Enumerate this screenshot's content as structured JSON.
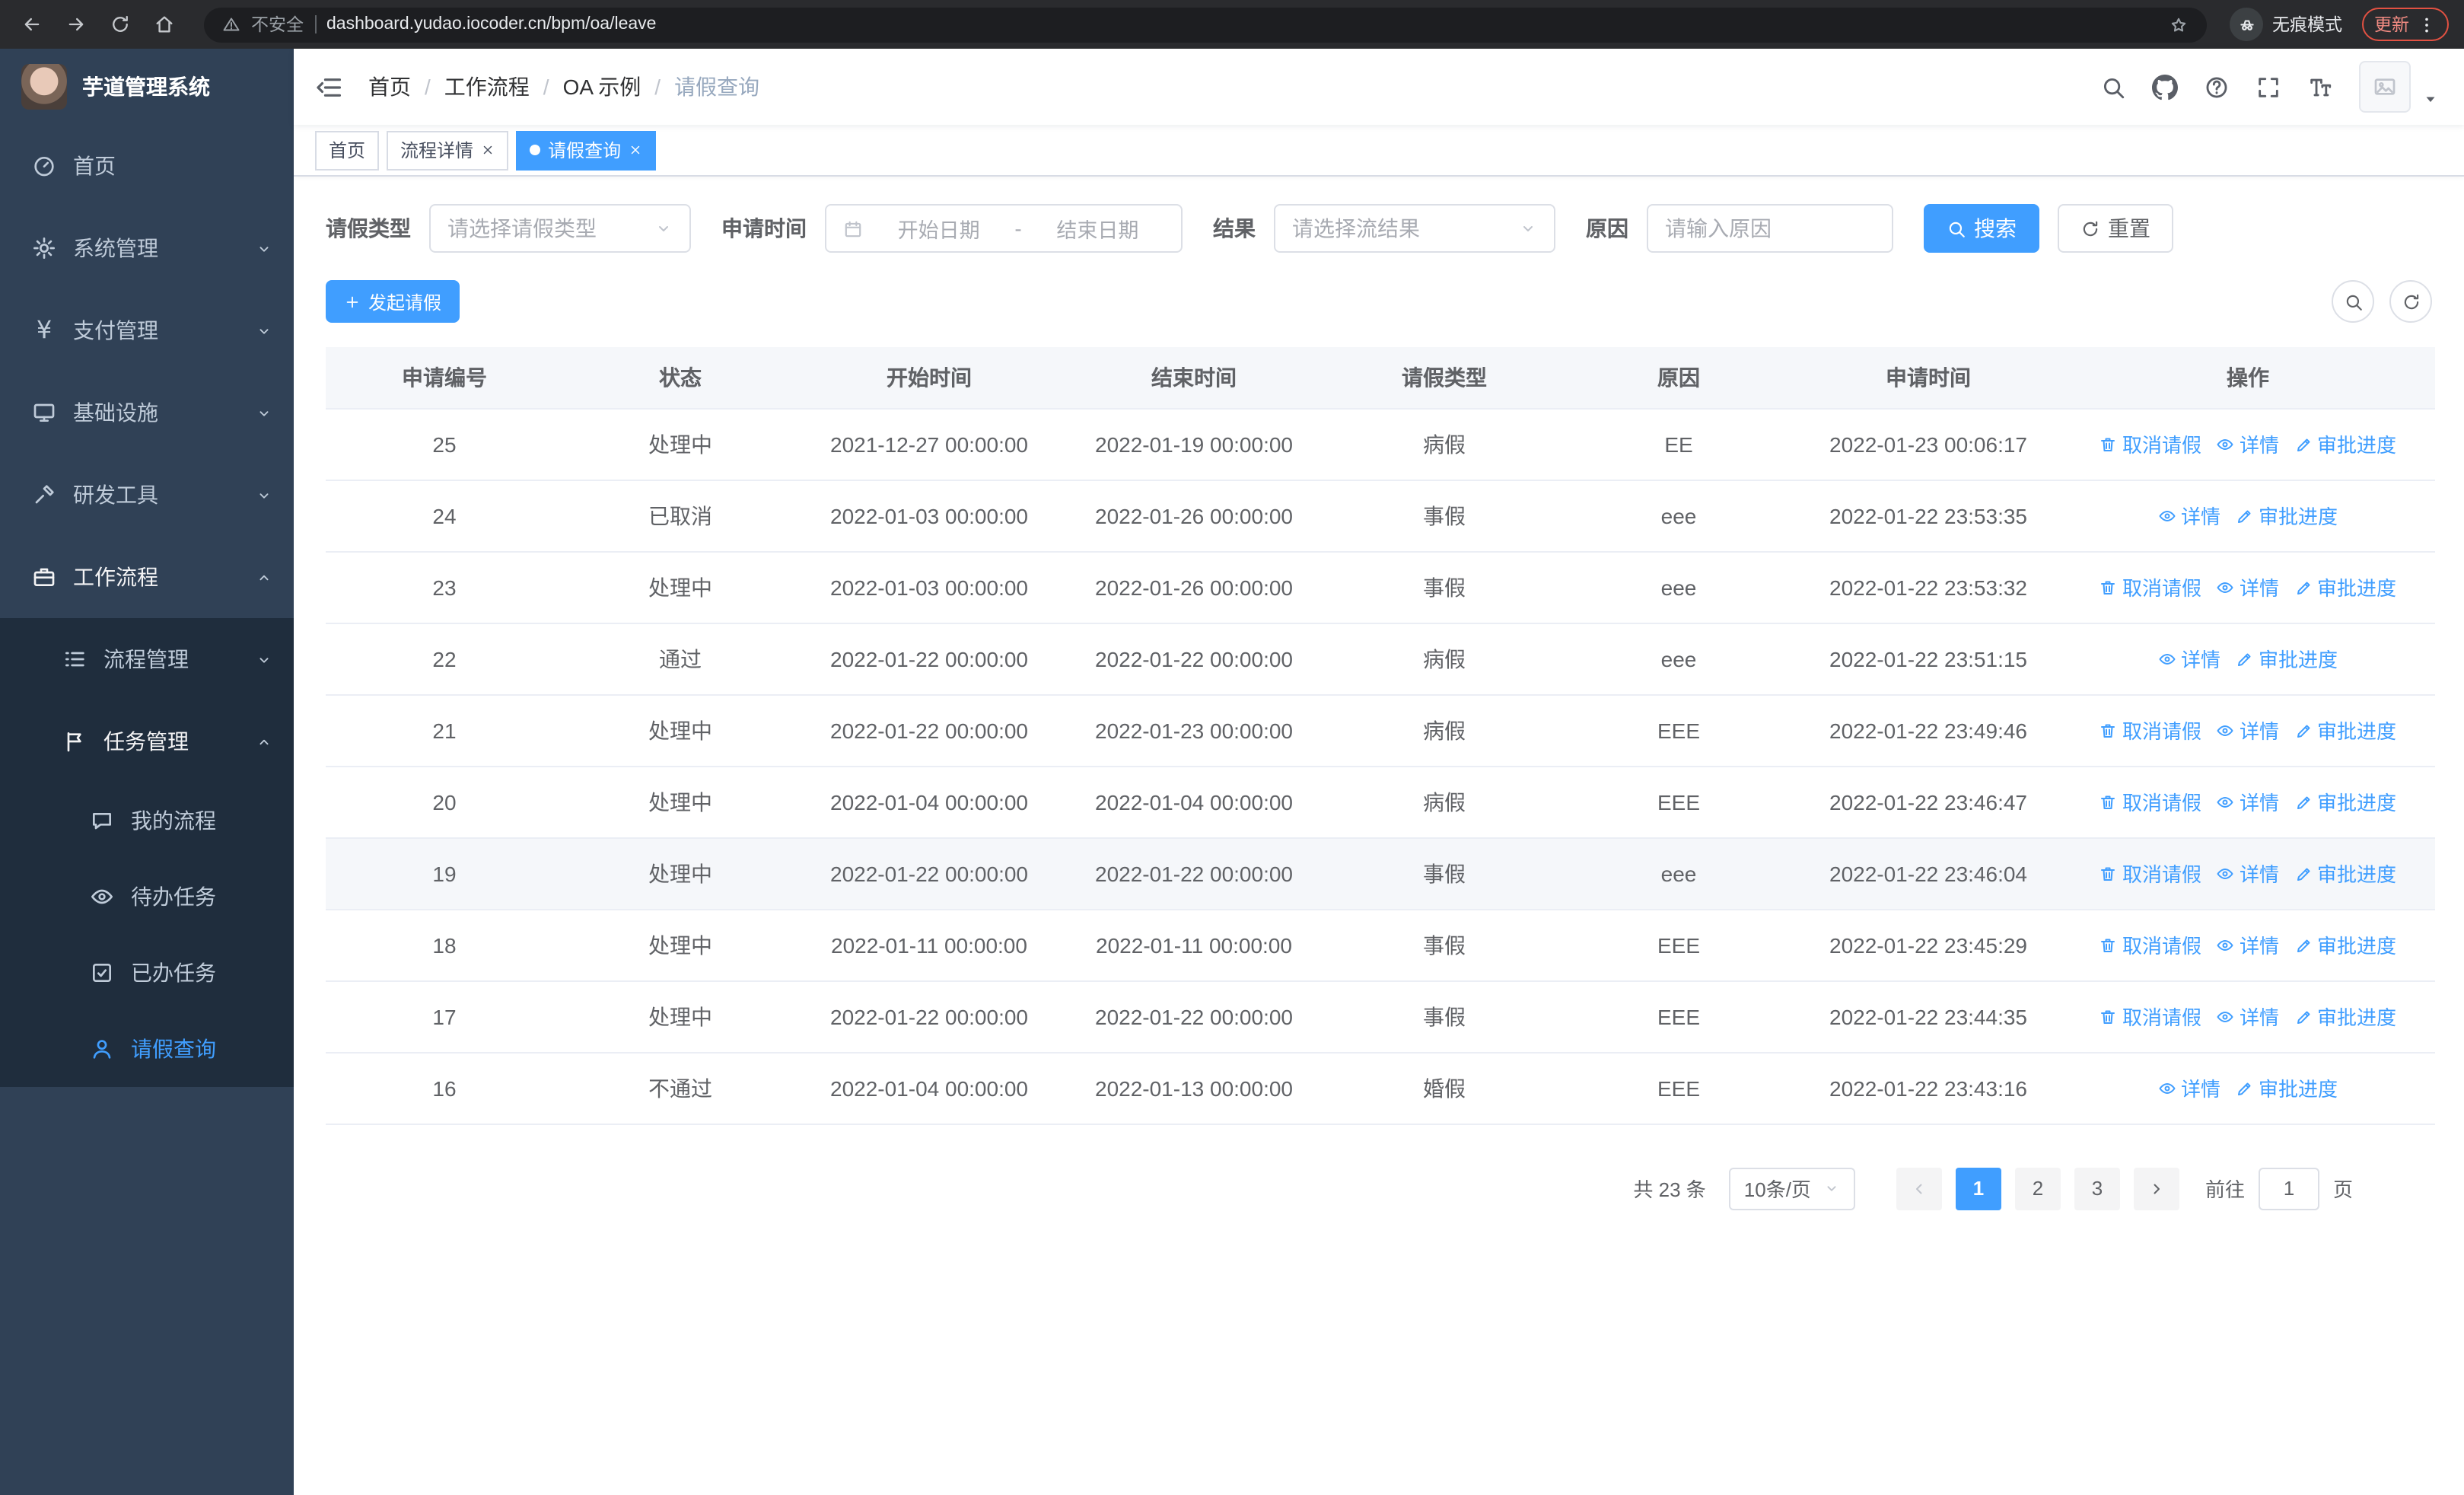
{
  "browser": {
    "security_label": "不安全",
    "url": "dashboard.yudao.iocoder.cn/bpm/oa/leave",
    "incognito_label": "无痕模式",
    "update_label": "更新"
  },
  "sidebar": {
    "app_title": "芋道管理系统",
    "items": [
      {
        "label": "首页",
        "icon": "dashboard-icon",
        "level": 1
      },
      {
        "label": "系统管理",
        "icon": "gear-icon",
        "level": 1,
        "arrow": "down"
      },
      {
        "label": "支付管理",
        "icon": "yen-icon",
        "level": 1,
        "arrow": "down"
      },
      {
        "label": "基础设施",
        "icon": "infra-icon",
        "level": 1,
        "arrow": "down"
      },
      {
        "label": "研发工具",
        "icon": "tool-icon",
        "level": 1,
        "arrow": "down"
      },
      {
        "label": "工作流程",
        "icon": "workflow-icon",
        "level": 1,
        "arrow": "up",
        "expanded": true
      },
      {
        "label": "流程管理",
        "icon": "process-icon",
        "level": 2,
        "arrow": "down"
      },
      {
        "label": "任务管理",
        "icon": "task-icon",
        "level": 2,
        "arrow": "up",
        "expanded": true
      },
      {
        "label": "我的流程",
        "icon": "chat-icon",
        "level": 3
      },
      {
        "label": "待办任务",
        "icon": "eye-icon",
        "level": 3
      },
      {
        "label": "已办任务",
        "icon": "done-icon",
        "level": 3
      },
      {
        "label": "请假查询",
        "icon": "user-icon",
        "level": 3,
        "active": true
      }
    ]
  },
  "navbar": {
    "breadcrumb": [
      "首页",
      "工作流程",
      "OA 示例",
      "请假查询"
    ]
  },
  "tabs": [
    {
      "label": "首页",
      "closable": false,
      "active": false
    },
    {
      "label": "流程详情",
      "closable": true,
      "active": false
    },
    {
      "label": "请假查询",
      "closable": true,
      "active": true
    }
  ],
  "filters": {
    "leave_type_label": "请假类型",
    "leave_type_placeholder": "请选择请假类型",
    "apply_time_label": "申请时间",
    "date_start_placeholder": "开始日期",
    "date_separator": "-",
    "date_end_placeholder": "结束日期",
    "result_label": "结果",
    "result_placeholder": "请选择流结果",
    "reason_label": "原因",
    "reason_placeholder": "请输入原因",
    "search_label": "搜索",
    "reset_label": "重置"
  },
  "toolbar": {
    "create_label": "发起请假"
  },
  "table": {
    "columns": [
      "申请编号",
      "状态",
      "开始时间",
      "结束时间",
      "请假类型",
      "原因",
      "申请时间",
      "操作"
    ],
    "op_labels": {
      "cancel": "取消请假",
      "detail": "详情",
      "progress": "审批进度"
    },
    "rows": [
      {
        "id": "25",
        "status": "处理中",
        "start": "2021-12-27 00:00:00",
        "end": "2022-01-19 00:00:00",
        "type": "病假",
        "reason": "EE",
        "applied": "2022-01-23 00:06:17",
        "ops": [
          "cancel",
          "detail",
          "progress"
        ],
        "highlight": false
      },
      {
        "id": "24",
        "status": "已取消",
        "start": "2022-01-03 00:00:00",
        "end": "2022-01-26 00:00:00",
        "type": "事假",
        "reason": "eee",
        "applied": "2022-01-22 23:53:35",
        "ops": [
          "detail",
          "progress"
        ],
        "highlight": false
      },
      {
        "id": "23",
        "status": "处理中",
        "start": "2022-01-03 00:00:00",
        "end": "2022-01-26 00:00:00",
        "type": "事假",
        "reason": "eee",
        "applied": "2022-01-22 23:53:32",
        "ops": [
          "cancel",
          "detail",
          "progress"
        ],
        "highlight": false
      },
      {
        "id": "22",
        "status": "通过",
        "start": "2022-01-22 00:00:00",
        "end": "2022-01-22 00:00:00",
        "type": "病假",
        "reason": "eee",
        "applied": "2022-01-22 23:51:15",
        "ops": [
          "detail",
          "progress"
        ],
        "highlight": false
      },
      {
        "id": "21",
        "status": "处理中",
        "start": "2022-01-22 00:00:00",
        "end": "2022-01-23 00:00:00",
        "type": "病假",
        "reason": "EEE",
        "applied": "2022-01-22 23:49:46",
        "ops": [
          "cancel",
          "detail",
          "progress"
        ],
        "highlight": false
      },
      {
        "id": "20",
        "status": "处理中",
        "start": "2022-01-04 00:00:00",
        "end": "2022-01-04 00:00:00",
        "type": "病假",
        "reason": "EEE",
        "applied": "2022-01-22 23:46:47",
        "ops": [
          "cancel",
          "detail",
          "progress"
        ],
        "highlight": false
      },
      {
        "id": "19",
        "status": "处理中",
        "start": "2022-01-22 00:00:00",
        "end": "2022-01-22 00:00:00",
        "type": "事假",
        "reason": "eee",
        "applied": "2022-01-22 23:46:04",
        "ops": [
          "cancel",
          "detail",
          "progress"
        ],
        "highlight": true
      },
      {
        "id": "18",
        "status": "处理中",
        "start": "2022-01-11 00:00:00",
        "end": "2022-01-11 00:00:00",
        "type": "事假",
        "reason": "EEE",
        "applied": "2022-01-22 23:45:29",
        "ops": [
          "cancel",
          "detail",
          "progress"
        ],
        "highlight": false
      },
      {
        "id": "17",
        "status": "处理中",
        "start": "2022-01-22 00:00:00",
        "end": "2022-01-22 00:00:00",
        "type": "事假",
        "reason": "EEE",
        "applied": "2022-01-22 23:44:35",
        "ops": [
          "cancel",
          "detail",
          "progress"
        ],
        "highlight": false
      },
      {
        "id": "16",
        "status": "不通过",
        "start": "2022-01-04 00:00:00",
        "end": "2022-01-13 00:00:00",
        "type": "婚假",
        "reason": "EEE",
        "applied": "2022-01-22 23:43:16",
        "ops": [
          "detail",
          "progress"
        ],
        "highlight": false
      }
    ]
  },
  "pagination": {
    "total_label": "共 23 条",
    "page_size": "10条/页",
    "pages": [
      "1",
      "2",
      "3"
    ],
    "current": "1",
    "goto_label": "前往",
    "goto_value": "1",
    "page_label": "页"
  },
  "colors": {
    "primary": "#409eff",
    "sidebar_bg": "#304156",
    "sidebar_submenu_bg": "#1f2d3d"
  }
}
